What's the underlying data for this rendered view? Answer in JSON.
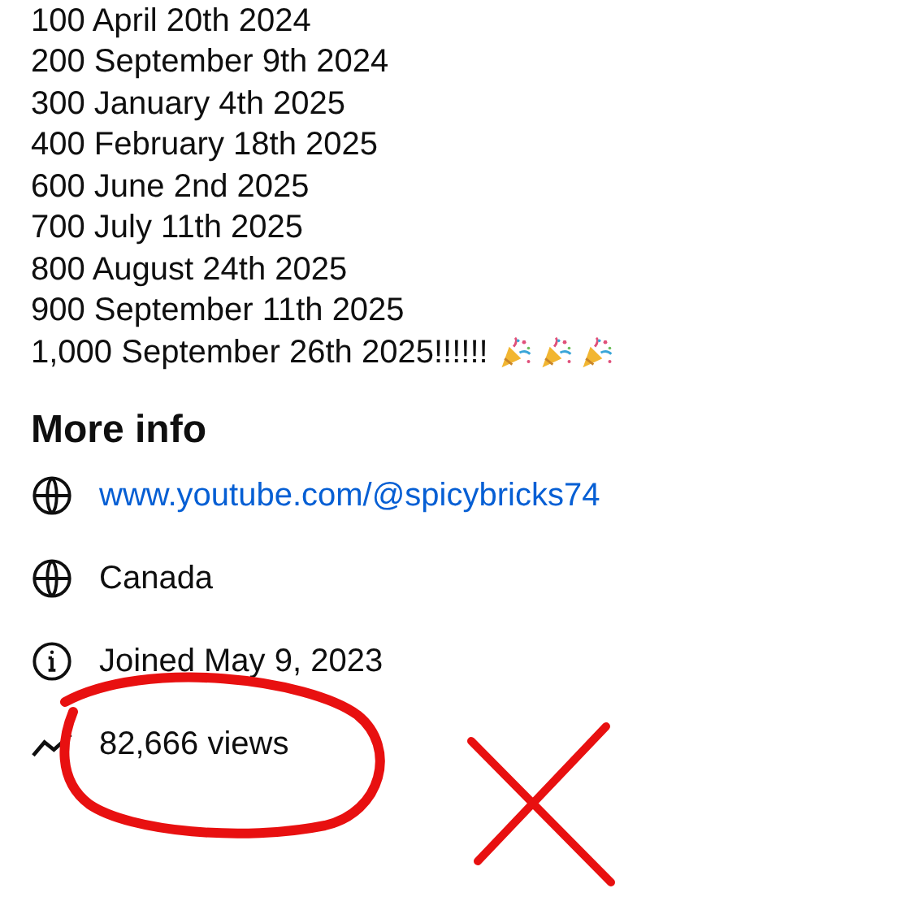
{
  "milestones": [
    "100 April 20th 2024",
    "200 September 9th 2024",
    "300 January 4th 2025",
    "400 February 18th 2025",
    "600 June 2nd 2025",
    "700 July 11th 2025",
    "800 August 24th 2025",
    "900 September 11th 2025",
    "1,000 September 26th 2025!!!!!!"
  ],
  "more_info": {
    "title": "More info",
    "rows": [
      {
        "kind": "link",
        "text": "www.youtube.com/@spicybricks74"
      },
      {
        "kind": "country",
        "text": "Canada"
      },
      {
        "kind": "joined",
        "text": "Joined May 9, 2023"
      },
      {
        "kind": "views",
        "text": "82,666 views"
      }
    ]
  }
}
